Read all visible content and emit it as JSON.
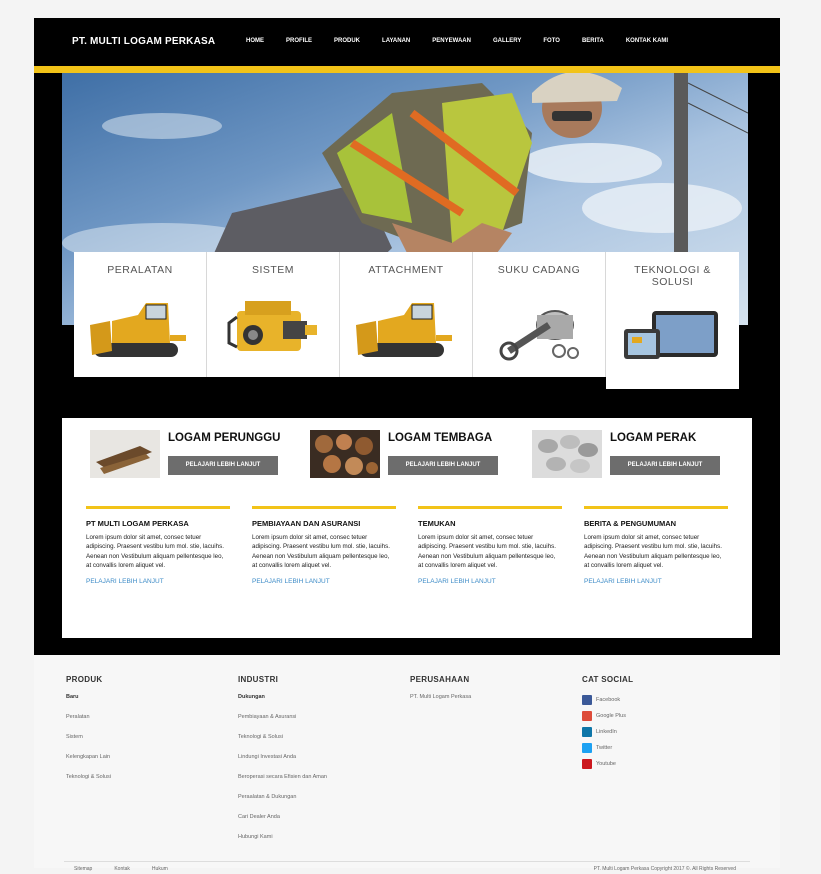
{
  "brand": "PT. MULTI LOGAM PERKASA",
  "nav": [
    "HOME",
    "PROFILE",
    "PRODUK",
    "LAYANAN",
    "PENYEWAAN",
    "GALLERY",
    "FOTO",
    "BERITA",
    "KONTAK KAMI"
  ],
  "tiles": [
    {
      "label": "PERALATAN",
      "icon": "bulldozer-image"
    },
    {
      "label": "SISTEM",
      "icon": "engine-image"
    },
    {
      "label": "ATTACHMENT",
      "icon": "bulldozer-image"
    },
    {
      "label": "SUKU CADANG",
      "icon": "piston-image"
    },
    {
      "label": "TEKNOLOGI & SOLUSI",
      "icon": "monitor-devices-image"
    }
  ],
  "metals": [
    {
      "title": "LOGAM PERUNGGU",
      "button": "PELAJARI LEBIH LANJUT"
    },
    {
      "title": "LOGAM TEMBAGA",
      "button": "PELAJARI LEBIH LANJUT"
    },
    {
      "title": "LOGAM PERAK",
      "button": "PELAJARI LEBIH LANJUT"
    }
  ],
  "columns": [
    {
      "title": "PT MULTI LOGAM PERKASA",
      "text": "Lorem ipsum dolor sit amet, consec tetuer adipiscing. Praesent vestibu lum mol. stie, lacuihs. Aenean non Vestibulum aliquam pellentesque leo, at convallis lorem aliquet vel.",
      "link": "PELAJARI LEBIH LANJUT"
    },
    {
      "title": "PEMBIAYAAN DAN ASURANSI",
      "text": "Lorem ipsum dolor sit amet, consec tetuer adipiscing. Praesent vestibu lum mol. stie, lacuihs. Aenean non Vestibulum aliquam pellentesque leo, at convallis lorem aliquet vel.",
      "link": "PELAJARI LEBIH LANJUT"
    },
    {
      "title": "TEMUKAN",
      "text": "Lorem ipsum dolor sit amet, consec tetuer adipiscing. Praesent vestibu lum mol. stie, lacuihs. Aenean non Vestibulum aliquam pellentesque leo, at convallis lorem aliquet vel.",
      "link": "PELAJARI LEBIH LANJUT"
    },
    {
      "title": "BERITA & PENGUMUMAN",
      "text": "Lorem ipsum dolor sit amet, consec tetuer adipiscing. Praesent vestibu lum mol. stie, lacuihs. Aenean non Vestibulum aliquam pellentesque leo, at convallis lorem aliquet vel.",
      "link": "PELAJARI LEBIH LANJUT"
    }
  ],
  "footer": {
    "produk": {
      "title": "PRODUK",
      "items": [
        "Baru",
        "Peralatan",
        "Sistem",
        "Kelengkapan Lain",
        "Teknologi & Solusi"
      ]
    },
    "industri": {
      "title": "INDUSTRI",
      "items": [
        "Dukungan",
        "Pembiayaan & Asuransi",
        "Teknologi & Solusi",
        "Lindungi Investasi Anda",
        "Beroperasi secara Efisien dan Aman",
        "Peraalatan & Dukungan",
        "Cari Dealer Anda",
        "Hubungi Kami"
      ]
    },
    "perusahaan": {
      "title": "PERUSAHAAN",
      "items": [
        "PT. Multi Logam Perkasa"
      ]
    },
    "social": {
      "title": "CAT SOCIAL",
      "items": [
        {
          "label": "Facebook",
          "color": "#3b5998"
        },
        {
          "label": "Google Plus",
          "color": "#dd4b39"
        },
        {
          "label": "LinkedIn",
          "color": "#0e76a8"
        },
        {
          "label": "Twitter",
          "color": "#1da1f2"
        },
        {
          "label": "Youtube",
          "color": "#cc181e"
        }
      ]
    },
    "bottom_links": [
      "Sitemap",
      "Kontak",
      "Hukum"
    ],
    "copyright": "PT. Multi Logam Perkasa Copyright 2017 ©. All Rights Reserved"
  },
  "colors": {
    "accent": "#f2c318",
    "header": "#000000",
    "link": "#3c8bc7",
    "button": "#6d6d6d"
  }
}
